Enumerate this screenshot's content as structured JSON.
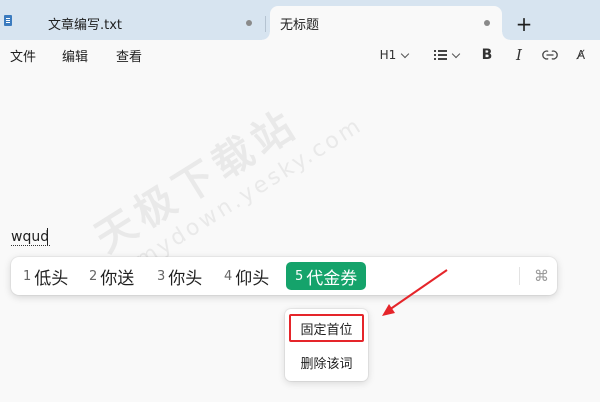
{
  "tabs": [
    {
      "label": "文章编写.txt",
      "unsaved": true
    },
    {
      "label": "无标题",
      "unsaved": true,
      "active": true
    }
  ],
  "new_tab_label": "+",
  "menu": {
    "file": "文件",
    "edit": "编辑",
    "view": "查看"
  },
  "toolbar": {
    "heading": "H1",
    "bold": "B",
    "italic": "I",
    "spell": "A̸",
    "icons": [
      "list-icon",
      "link-icon",
      "spellcheck-icon",
      "chevron-down-icon"
    ]
  },
  "watermark": {
    "brand": "天极下载站",
    "url": "mydown.yesky.com"
  },
  "editor": {
    "typed_text": "wqud"
  },
  "ime": {
    "candidates": [
      {
        "num": "1",
        "text": "低头"
      },
      {
        "num": "2",
        "text": "你送"
      },
      {
        "num": "3",
        "text": "你头"
      },
      {
        "num": "4",
        "text": "仰头"
      },
      {
        "num": "5",
        "text": "代金券",
        "selected": true
      }
    ],
    "command_glyph": "⌘",
    "highlight_color": "#15a36b"
  },
  "context_menu": {
    "items": [
      {
        "label": "固定首位",
        "highlighted": true
      },
      {
        "label": "删除该词"
      }
    ],
    "annotation_color": "#e5252a"
  }
}
